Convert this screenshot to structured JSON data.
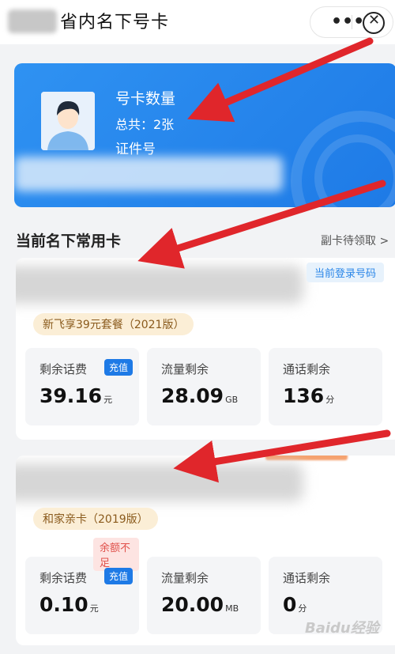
{
  "header": {
    "title": "省内名下号卡"
  },
  "summary_card": {
    "label": "号卡数量",
    "total": "总共：2张",
    "id_label": "证件号"
  },
  "section": {
    "title": "当前名下常用卡",
    "link": "副卡待领取 >"
  },
  "cards": [
    {
      "badge": "当前登录号码",
      "plan": "新飞享39元套餐（2021版）",
      "stats": [
        {
          "label": "剩余话费",
          "action": "充值",
          "value": "39.16",
          "unit": "元"
        },
        {
          "label": "流量剩余",
          "value": "28.09",
          "unit": "GB"
        },
        {
          "label": "通话剩余",
          "value": "136",
          "unit": "分"
        }
      ]
    },
    {
      "plan": "和家亲卡（2019版）",
      "warning": "余额不足",
      "stats": [
        {
          "label": "剩余话费",
          "action": "充值",
          "value": "0.10",
          "unit": "元"
        },
        {
          "label": "流量剩余",
          "value": "20.00",
          "unit": "MB"
        },
        {
          "label": "通话剩余",
          "value": "0",
          "unit": "分"
        }
      ]
    }
  ],
  "watermark": "Baidu经验",
  "colors": {
    "brand_blue": "#1e7ae6",
    "arrow_red": "#e0262b",
    "plan_tag_bg": "#fbeed6",
    "warning_red": "#e0504a"
  }
}
